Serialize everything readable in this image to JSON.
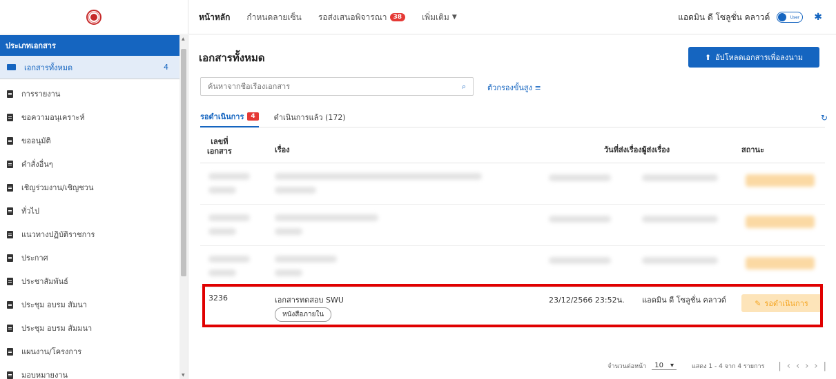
{
  "header": {
    "nav": [
      {
        "label": "หน้าหลัก"
      },
      {
        "label": "กำหนดลายเซ็น"
      },
      {
        "label": "รอส่งเสนอพิจารณา",
        "badge": "38"
      },
      {
        "label": "เพิ่มเติม"
      }
    ],
    "user_name": "แอดมิน ดี โซลูชั่น คลาวด์",
    "toggle_label": "User"
  },
  "sidebar": {
    "title": "ประเภทเอกสาร",
    "active_item": {
      "label": "เอกสารทั้งหมด",
      "count": "4"
    },
    "items": [
      "การรายงาน",
      "ขอความอนุเคราะห์",
      "ขออนุมัติ",
      "คำสั่งอื่นๆ",
      "เชิญร่วมงาน/เชิญชวน",
      "ทั่วไป",
      "แนวทางปฏิบัติราชการ",
      "ประกาศ",
      "ประชาสัมพันธ์",
      "ประชุม อบรม สัมนา",
      "ประชุม อบรม สัมมนา",
      "แผนงาน/โครงการ",
      "มอบหมายงาน"
    ]
  },
  "main": {
    "title": "เอกสารทั้งหมด",
    "upload_label": "อัปโหลดเอกสารเพื่อลงนาม",
    "search_placeholder": "ค้นหาจากชื่อเรื่องเอกสาร",
    "advanced_filter": "ตัวกรองขั้นสูง",
    "tabs": [
      {
        "label": "รอดำเนินการ",
        "badge": "4"
      },
      {
        "label": "ดำเนินการแล้ว (172)"
      }
    ],
    "columns": {
      "doc_no_1": "เลขที่",
      "doc_no_2": "เอกสาร",
      "subject": "เรื่อง",
      "sent_date": "วันที่ส่งเรื่องมา",
      "sender": "ผู้ส่งเรื่อง",
      "status": "สถานะ"
    },
    "row": {
      "doc_no": "3236",
      "subject": "เอกสารทดสอบ SWU",
      "tag": "หนังสือภายใน",
      "sent_date": "23/12/2566 23:52น.",
      "sender": "แอดมิน ดี โซลูชั่น คลาวด์",
      "status": "รอดำเนินการ"
    },
    "pager": {
      "per_page_label": "จำนวนต่อหน้า",
      "per_page": "10",
      "range": "แสดง 1 - 4 จาก 4 รายการ"
    }
  },
  "colors": {
    "primary": "#1565c0",
    "alert": "#e53935",
    "status_bg": "#fde4b9",
    "status_fg": "#f5a623",
    "highlight": "#e00000"
  }
}
